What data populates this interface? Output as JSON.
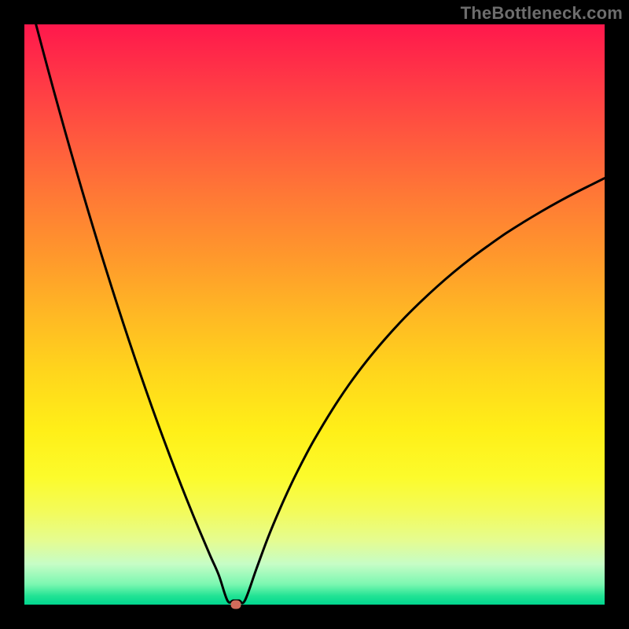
{
  "watermark": "TheBottleneck.com",
  "colors": {
    "background": "#000000",
    "curve": "#000000",
    "dot": "#d16b5b"
  },
  "chart_data": {
    "type": "line",
    "title": "",
    "xlabel": "",
    "ylabel": "",
    "xlim": [
      0,
      100
    ],
    "ylim": [
      0,
      100
    ],
    "grid": false,
    "legend": false,
    "minimum_x": 36,
    "dot": {
      "x": 36.5,
      "y": 0
    },
    "series": [
      {
        "name": "left-branch",
        "x": [
          2,
          4,
          6,
          8,
          10,
          12,
          14,
          16,
          18,
          20,
          22,
          24,
          26,
          28,
          30,
          32,
          33.5,
          35
        ],
        "values": [
          100,
          92.5,
          85.2,
          78.1,
          71.2,
          64.5,
          58.0,
          51.7,
          45.6,
          39.7,
          34.0,
          28.5,
          23.2,
          18.1,
          13.2,
          8.5,
          5.1,
          0.7
        ]
      },
      {
        "name": "right-branch",
        "x": [
          38,
          40,
          42,
          44,
          46,
          48,
          50,
          53,
          56,
          59,
          62,
          65,
          68,
          71,
          74,
          77,
          80,
          83,
          86,
          89,
          92,
          95,
          98,
          100
        ],
        "values": [
          0.7,
          6.2,
          11.6,
          16.4,
          20.8,
          24.8,
          28.5,
          33.5,
          38.0,
          42.0,
          45.6,
          48.9,
          51.9,
          54.7,
          57.3,
          59.7,
          61.9,
          64.0,
          65.9,
          67.7,
          69.4,
          71.0,
          72.5,
          73.5
        ]
      },
      {
        "name": "plateau",
        "x": [
          35,
          36,
          37,
          38
        ],
        "values": [
          0.7,
          0.7,
          0.7,
          0.7
        ]
      }
    ]
  }
}
